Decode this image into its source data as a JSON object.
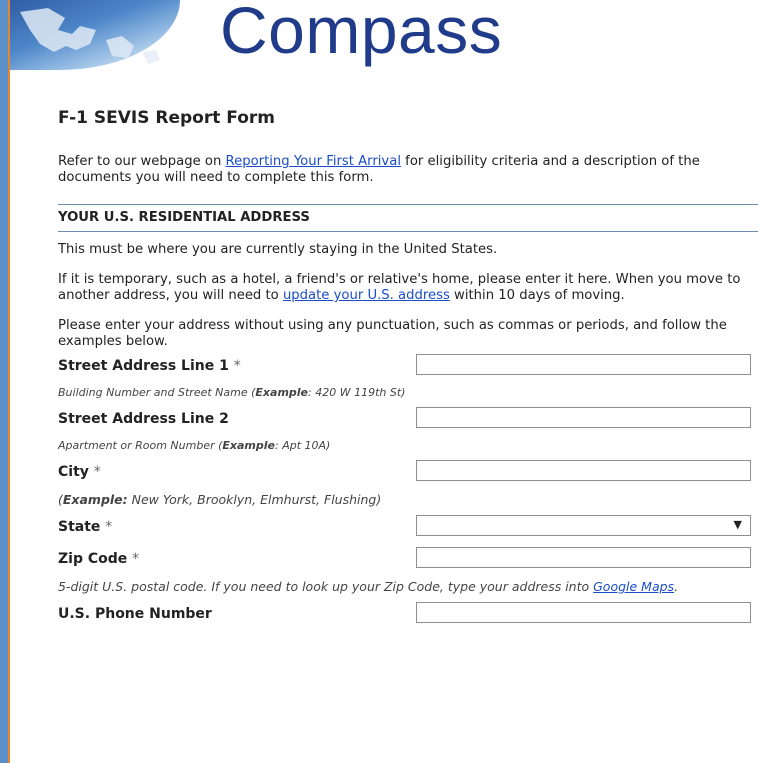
{
  "header": {
    "logo_text": "Compass"
  },
  "form": {
    "title": "F-1 SEVIS Report Form",
    "intro_prefix": "Refer to our webpage on ",
    "intro_link": "Reporting Your First Arrival",
    "intro_suffix": " for eligibility criteria and a description of the documents you will need to complete this form."
  },
  "section": {
    "heading": "YOUR U.S. RESIDENTIAL ADDRESS",
    "para1": "This must be where you are currently staying in the United States.",
    "para2_prefix": "If it is temporary, such as a hotel, a friend's or relative's home, please enter it here. When you move to another address, you will need to ",
    "para2_link": "update your U.S. address",
    "para2_suffix": " within 10 days of moving.",
    "para3": "Please enter your address without using any punctuation, such as commas or periods, and follow the examples below."
  },
  "fields": {
    "street1": {
      "label": "Street Address Line 1",
      "req": "*",
      "value": ""
    },
    "street1_hint_prefix": "Building Number and Street Name (",
    "street1_hint_bold": "Example",
    "street1_hint_suffix": ": 420 W 119th St)",
    "street2": {
      "label": "Street Address Line 2",
      "value": ""
    },
    "street2_hint_prefix": "Apartment or Room Number (",
    "street2_hint_bold": "Example",
    "street2_hint_suffix": ": Apt 10A)",
    "city": {
      "label": "City",
      "req": "*",
      "value": ""
    },
    "city_hint_prefix": "(",
    "city_hint_bold": "Example:",
    "city_hint_suffix": " New York, Brooklyn, Elmhurst, Flushing)",
    "state": {
      "label": "State",
      "req": "*",
      "value": "",
      "arrow": "▼"
    },
    "zip": {
      "label": "Zip Code",
      "req": "*",
      "value": ""
    },
    "zip_hint_prefix": "5-digit U.S. postal code. If you need to look up your Zip Code, type your address into ",
    "zip_hint_link": "Google Maps",
    "zip_hint_suffix": ".",
    "phone": {
      "label": "U.S. Phone Number",
      "value": ""
    }
  }
}
